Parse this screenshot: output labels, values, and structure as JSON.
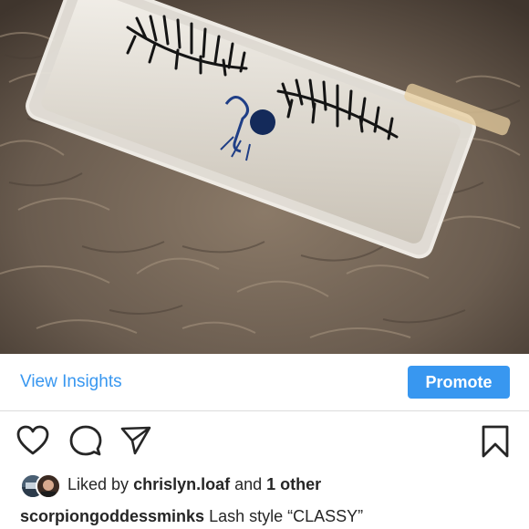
{
  "post": {
    "photo_alt": "",
    "insights": {
      "view_insights_label": "View Insights",
      "promote_label": "Promote"
    },
    "actions": {
      "like_icon": "heart-icon",
      "comment_icon": "comment-icon",
      "share_icon": "paper-plane-icon",
      "save_icon": "bookmark-icon"
    },
    "likes": {
      "prefix": "Liked by",
      "first_user": "chrislyn.loaf",
      "conjunction": "and",
      "others": "1 other"
    },
    "caption": {
      "username": "scorpiongoddessminks",
      "text": "Lash style “CLASSY”"
    }
  },
  "colors": {
    "accent": "#3897f0",
    "text": "#262626",
    "divider": "#dbdbdb"
  }
}
